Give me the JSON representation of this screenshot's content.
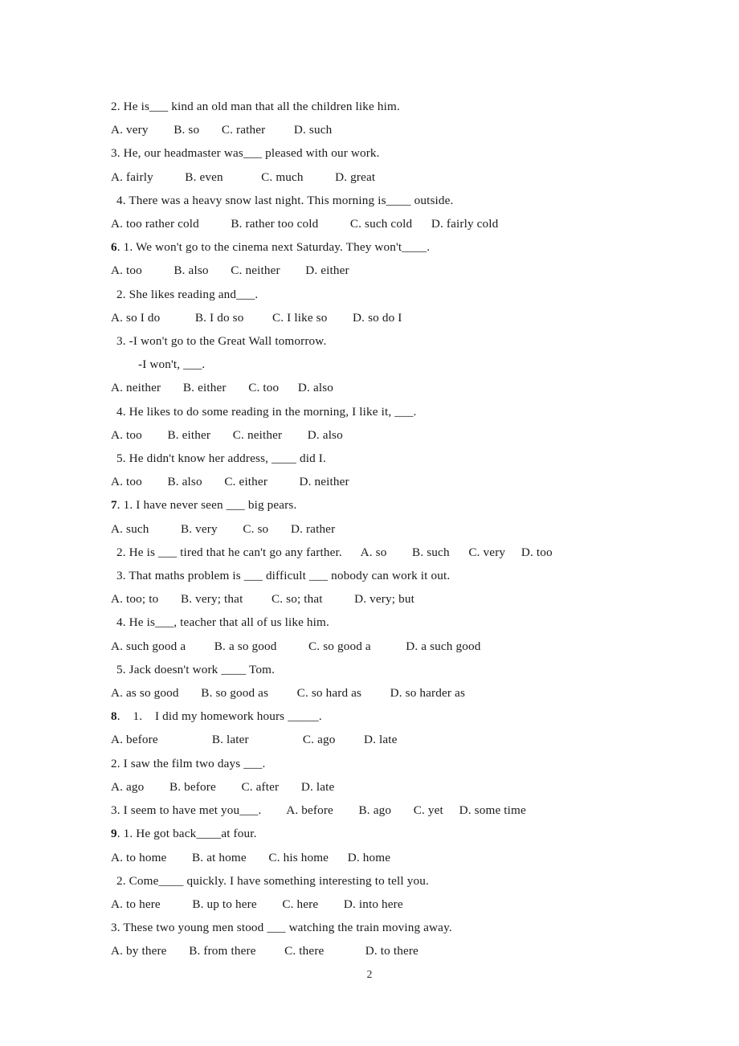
{
  "document": {
    "page_number": "2",
    "lines": [
      {
        "id": "l1",
        "indent": 0,
        "text": "2. He is___ kind an old man that all the children like him."
      },
      {
        "id": "l2",
        "indent": 0,
        "text": "A. very        B. so       C. rather         D. such"
      },
      {
        "id": "l3",
        "indent": 0,
        "text": "3. He, our headmaster was___ pleased with our work."
      },
      {
        "id": "l4",
        "indent": 0,
        "text": "A. fairly          B. even            C. much          D. great"
      },
      {
        "id": "l5",
        "indent": 1,
        "text": "4. There was a heavy snow last night. This morning is____ outside."
      },
      {
        "id": "l6",
        "indent": 0,
        "text": "A. too rather cold          B. rather too cold          C. such cold      D. fairly cold"
      },
      {
        "id": "l7",
        "indent": 0,
        "section": "6",
        "text": ". 1. We won't go to the cinema next Saturday. They won't____."
      },
      {
        "id": "l8",
        "indent": 0,
        "text": "A. too          B. also       C. neither        D. either"
      },
      {
        "id": "l9",
        "indent": 1,
        "text": "2. She likes reading and___."
      },
      {
        "id": "l10",
        "indent": 0,
        "text": "A. so I do           B. I do so         C. I like so        D. so do I"
      },
      {
        "id": "l11",
        "indent": 1,
        "text": "3. -I won't go to the Great Wall tomorrow."
      },
      {
        "id": "l12",
        "indent": 2,
        "text": "-I won't, ___."
      },
      {
        "id": "l13",
        "indent": 0,
        "text": "A. neither       B. either       C. too      D. also"
      },
      {
        "id": "l14",
        "indent": 1,
        "text": "4. He likes to do some reading in the morning, I like it, ___."
      },
      {
        "id": "l15",
        "indent": 0,
        "text": "A. too        B. either       C. neither        D. also"
      },
      {
        "id": "l16",
        "indent": 1,
        "text": "5. He didn't know her address, ____ did I."
      },
      {
        "id": "l17",
        "indent": 0,
        "text": "A. too        B. also       C. either          D. neither"
      },
      {
        "id": "l18",
        "indent": 0,
        "section": "7",
        "text": ". 1. I have never seen ___ big pears."
      },
      {
        "id": "l19",
        "indent": 0,
        "text": "A. such          B. very        C. so       D. rather"
      },
      {
        "id": "l20",
        "indent": 1,
        "text": "2. He is ___ tired that he can't go any farther.      A. so        B. such      C. very     D. too"
      },
      {
        "id": "l21",
        "indent": 1,
        "text": "3. That maths problem is ___ difficult ___ nobody can work it out."
      },
      {
        "id": "l22",
        "indent": 0,
        "text": "A. too; to       B. very; that         C. so; that          D. very; but"
      },
      {
        "id": "l23",
        "indent": 1,
        "text": "4. He is___, teacher that all of us like him."
      },
      {
        "id": "l24",
        "indent": 0,
        "text": "A. such good a         B. a so good          C. so good a           D. a such good"
      },
      {
        "id": "l25",
        "indent": 1,
        "text": "5. Jack doesn't work ____ Tom."
      },
      {
        "id": "l26",
        "indent": 0,
        "text": "A. as so good       B. so good as         C. so hard as         D. so harder as"
      },
      {
        "id": "l27",
        "indent": 0,
        "section": "8",
        "text": ".    1.    I did my homework hours _____."
      },
      {
        "id": "l28",
        "indent": 0,
        "text": "A. before                 B. later                 C. ago         D. late"
      },
      {
        "id": "l29",
        "indent": 0,
        "text": "2. I saw the film two days ___."
      },
      {
        "id": "l30",
        "indent": 0,
        "text": "A. ago        B. before        C. after       D. late"
      },
      {
        "id": "l31",
        "indent": 0,
        "text": "3. I seem to have met you___.        A. before        B. ago       C. yet     D. some time"
      },
      {
        "id": "l32",
        "indent": 0,
        "section": "9",
        "text": ". 1. He got back____at four."
      },
      {
        "id": "l33",
        "indent": 0,
        "text": "A. to home        B. at home       C. his home      D. home"
      },
      {
        "id": "l34",
        "indent": 1,
        "text": "2. Come____ quickly. I have something interesting to tell you."
      },
      {
        "id": "l35",
        "indent": 0,
        "text": "A. to here          B. up to here        C. here        D. into here"
      },
      {
        "id": "l36",
        "indent": 0,
        "text": "3. These two young men stood ___ watching the train moving away."
      },
      {
        "id": "l37",
        "indent": 0,
        "text": "A. by there       B. from there         C. there             D. to there"
      }
    ]
  }
}
